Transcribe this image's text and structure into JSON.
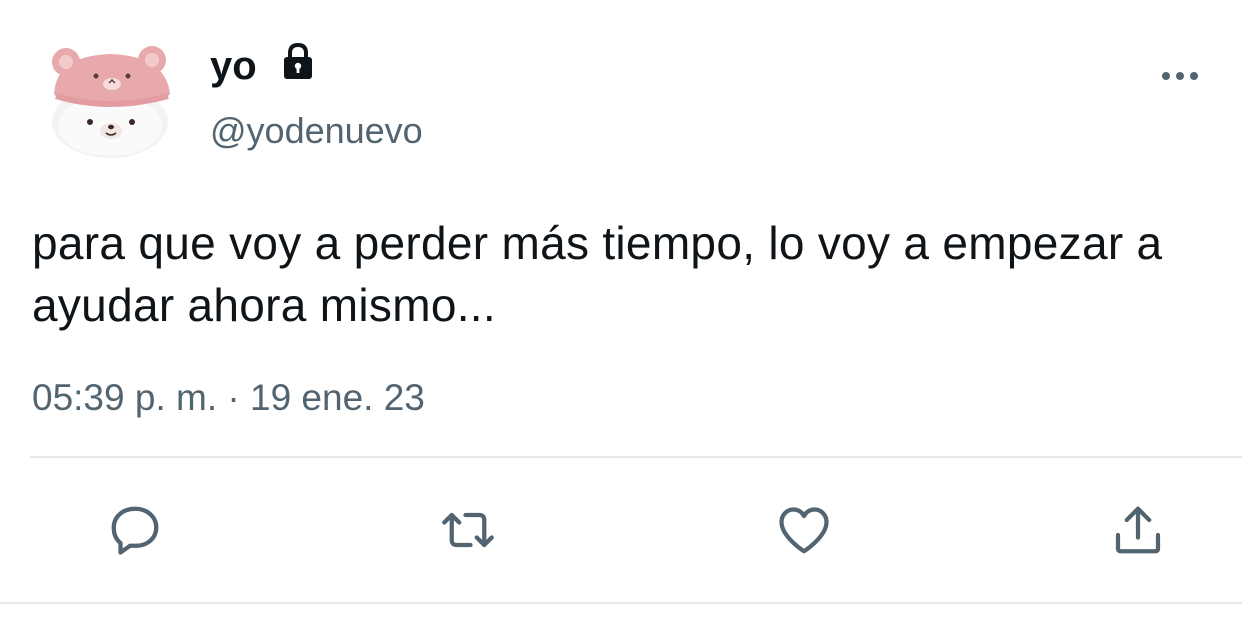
{
  "author": {
    "display_name": "yo",
    "handle": "@yodenuevo",
    "avatar": "pink-bear-hat-plush-avatar",
    "protected_icon": "lock-icon"
  },
  "tweet": {
    "text": "para que voy a perder más tiempo, lo voy a empezar a ayudar ahora mismo...",
    "timestamp": "05:39 p. m. · 19 ene. 23"
  },
  "menu": {
    "icon": "more-horizontal-icon"
  },
  "actions": [
    {
      "name": "reply",
      "icon": "reply-icon"
    },
    {
      "name": "retweet",
      "icon": "retweet-icon"
    },
    {
      "name": "like",
      "icon": "heart-icon"
    },
    {
      "name": "share",
      "icon": "share-icon"
    }
  ],
  "colors": {
    "text_primary": "#0f1419",
    "text_secondary": "#536471",
    "icon_gray": "#536471",
    "divider": "#e6e9ec",
    "avatar_pink": "#e9aeb2"
  }
}
